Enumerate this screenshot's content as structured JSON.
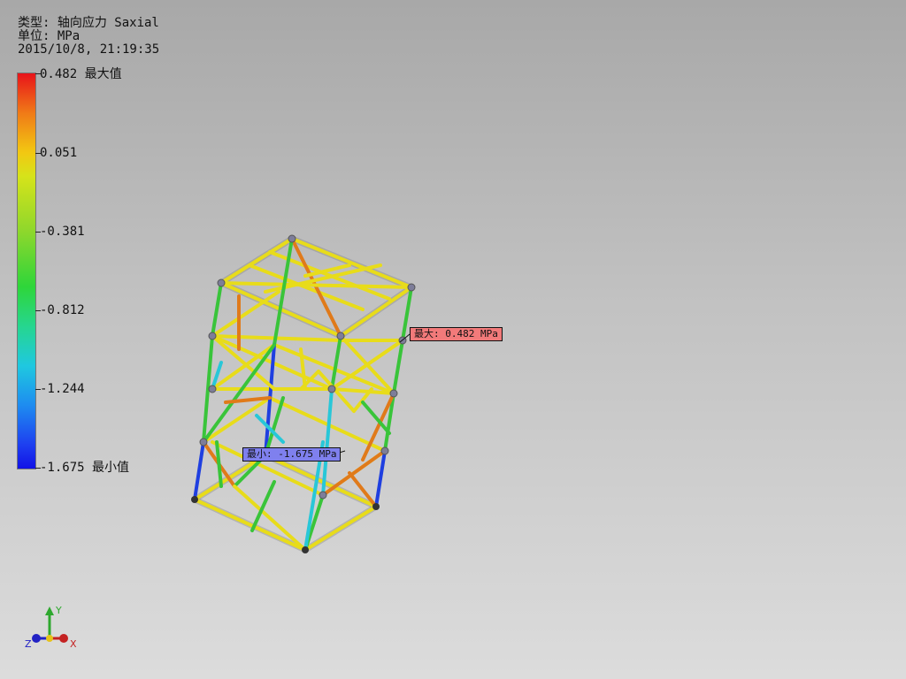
{
  "result": {
    "type_line": "类型: 轴向应力 Saxial",
    "unit_line": "单位: MPa",
    "time_line": "2015/10/8, 21:19:35"
  },
  "legend": {
    "labels": [
      {
        "text": "0.482 最大值"
      },
      {
        "text": "0.051"
      },
      {
        "text": "-0.381"
      },
      {
        "text": "-0.812"
      },
      {
        "text": "-1.244"
      },
      {
        "text": "-1.675 最小值"
      }
    ],
    "colors": {
      "max": "#e8131a",
      "min": "#1212e6"
    }
  },
  "probes": {
    "max_label": "最大: 0.482 MPa",
    "min_label": "最小: -1.675 MPa"
  },
  "triad": {
    "x": "X",
    "y": "Y",
    "z": "Z"
  },
  "colors": {
    "background_top": "#a8a8a8",
    "background_bottom": "#dcdcdc",
    "yellow": "#e8dc1a",
    "green": "#39c43a",
    "orange": "#e07a1a",
    "cyan": "#28c7d8",
    "blue": "#1f3fe0"
  }
}
